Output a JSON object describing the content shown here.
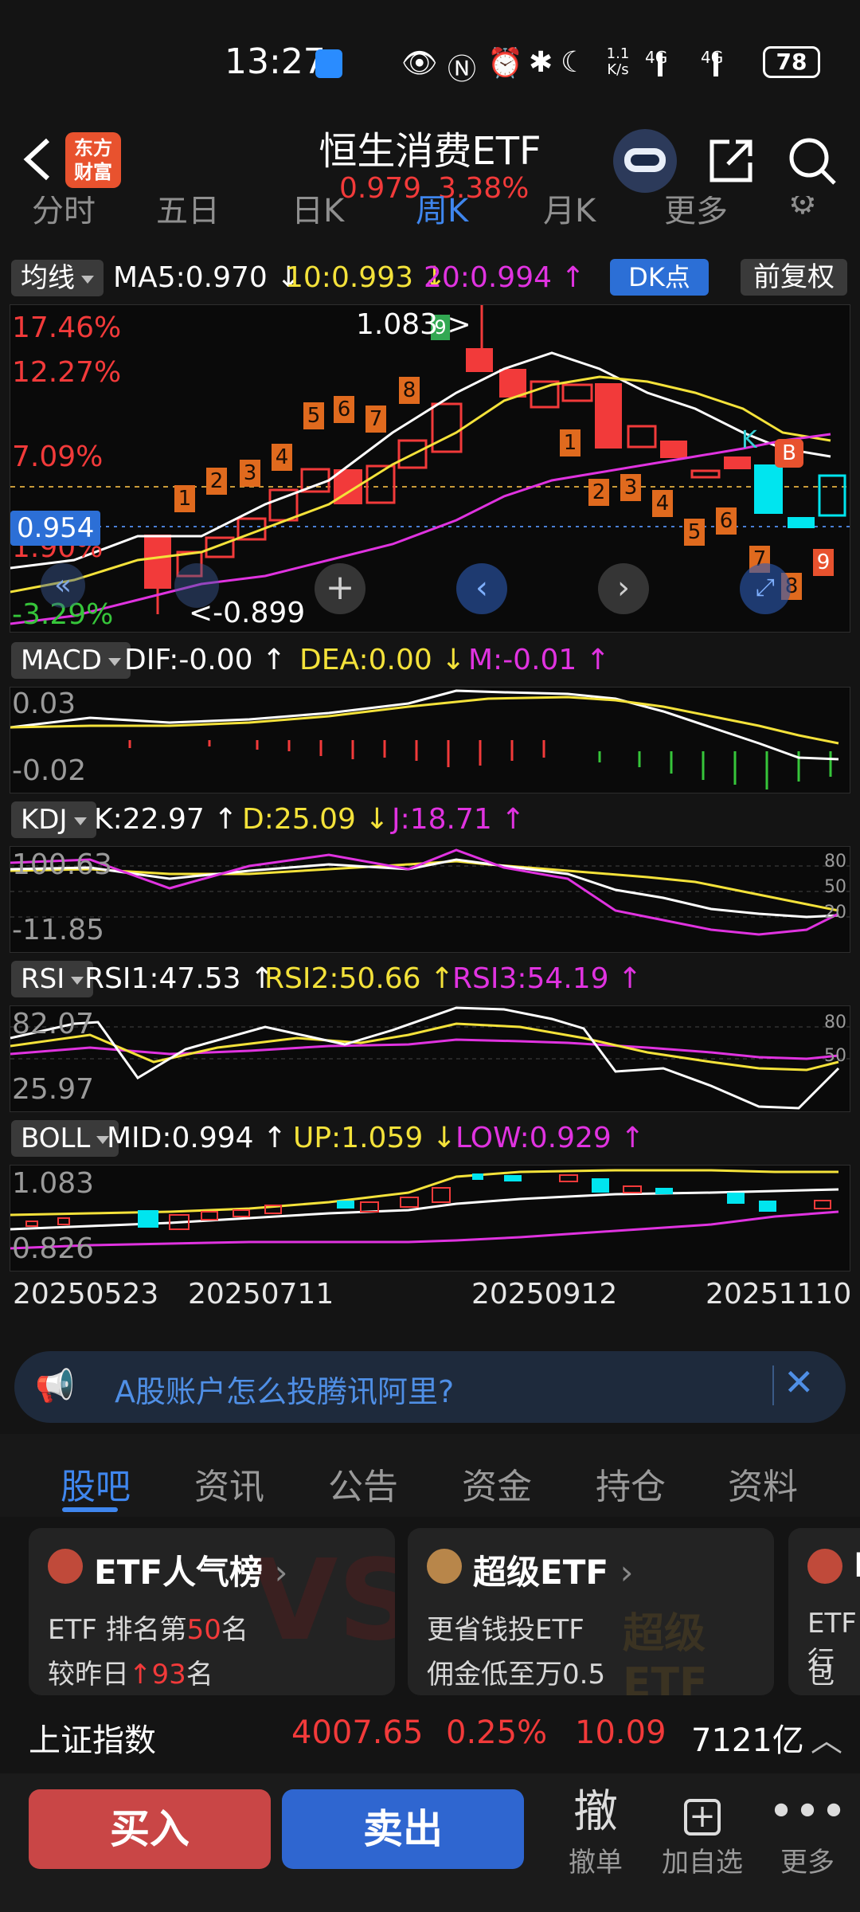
{
  "status": {
    "time": "13:27",
    "net_speed": "1.1\nK/s",
    "net1": "4G",
    "net2": "4G",
    "battery": "78"
  },
  "header": {
    "title": "恒生消费ETF",
    "price": "0.979",
    "change_pct": "3.38%",
    "logo_text": "东方财富"
  },
  "period_tabs": [
    "分时",
    "五日",
    "日K",
    "周K",
    "月K",
    "更多"
  ],
  "ma_bar": {
    "selector": "均线",
    "ma5": "MA5:0.970",
    "ma10": "10:0.993",
    "ma20": "20:0.994",
    "dk": "DK点",
    "adjust": "前复权"
  },
  "main_chart": {
    "pct_labels": [
      "17.46%",
      "12.27%",
      "7.09%",
      "1.90%",
      "-3.29%"
    ],
    "current_price_tag": "0.954",
    "high_label": "1.083",
    "low_label": "<-0.899",
    "signal_k": "K",
    "signal_b": "B"
  },
  "macd_bar": {
    "selector": "MACD",
    "dif": "DIF:-0.00",
    "dea": "DEA:0.00",
    "m": "M:-0.01"
  },
  "macd_axis": [
    "0.03",
    "-0.02"
  ],
  "kdj_bar": {
    "selector": "KDJ",
    "k": "K:22.97",
    "d": "D:25.09",
    "j": "J:18.71"
  },
  "kdj_axis": [
    "100.63",
    "-11.85"
  ],
  "kdj_levels": [
    "80",
    "50",
    "20"
  ],
  "rsi_bar": {
    "selector": "RSI",
    "rsi1": "RSI1:47.53",
    "rsi2": "RSI2:50.66",
    "rsi3": "RSI3:54.19"
  },
  "rsi_axis": [
    "82.07",
    "25.97"
  ],
  "rsi_levels": [
    "80",
    "50"
  ],
  "boll_bar": {
    "selector": "BOLL",
    "mid": "MID:0.994",
    "up": "UP:1.059",
    "low": "LOW:0.929"
  },
  "boll_axis": [
    "1.083",
    "0.826"
  ],
  "dates": [
    "20250523",
    "20250711",
    "20250912",
    "20251110"
  ],
  "ad": {
    "text": "A股账户怎么投腾讯阿里?"
  },
  "lower_tabs": [
    "股吧",
    "资讯",
    "公告",
    "资金",
    "持仓",
    "资料"
  ],
  "cards": [
    {
      "title": "ETF人气榜",
      "line1_prefix": "ETF 排名第",
      "line1_num": "50",
      "line1_suffix": "名",
      "line2_prefix": "较昨日",
      "line2_num": "93",
      "line2_suffix": "名",
      "watermark": "VS"
    },
    {
      "title": "超级ETF",
      "line1": "更省钱投ETF",
      "line2": "佣金低至万0.5",
      "watermark": "超级ETF"
    },
    {
      "title": "E",
      "line1": "ETF行",
      "line2": "包含"
    }
  ],
  "ticker": {
    "name": "上证指数",
    "value": "4007.65",
    "pct": "0.25%",
    "change": "10.09",
    "volume": "7121亿"
  },
  "bottom": {
    "buy": "买入",
    "sell": "卖出",
    "cancel_icon": "撤",
    "cancel": "撤单",
    "watch": "加自选",
    "more": "更多"
  },
  "colors": {
    "up": "#f23a3a",
    "down": "#00e5ef",
    "ma5": "#ffffff",
    "ma10": "#f4e23a",
    "ma20": "#e033e0",
    "accent": "#3f86ee"
  }
}
